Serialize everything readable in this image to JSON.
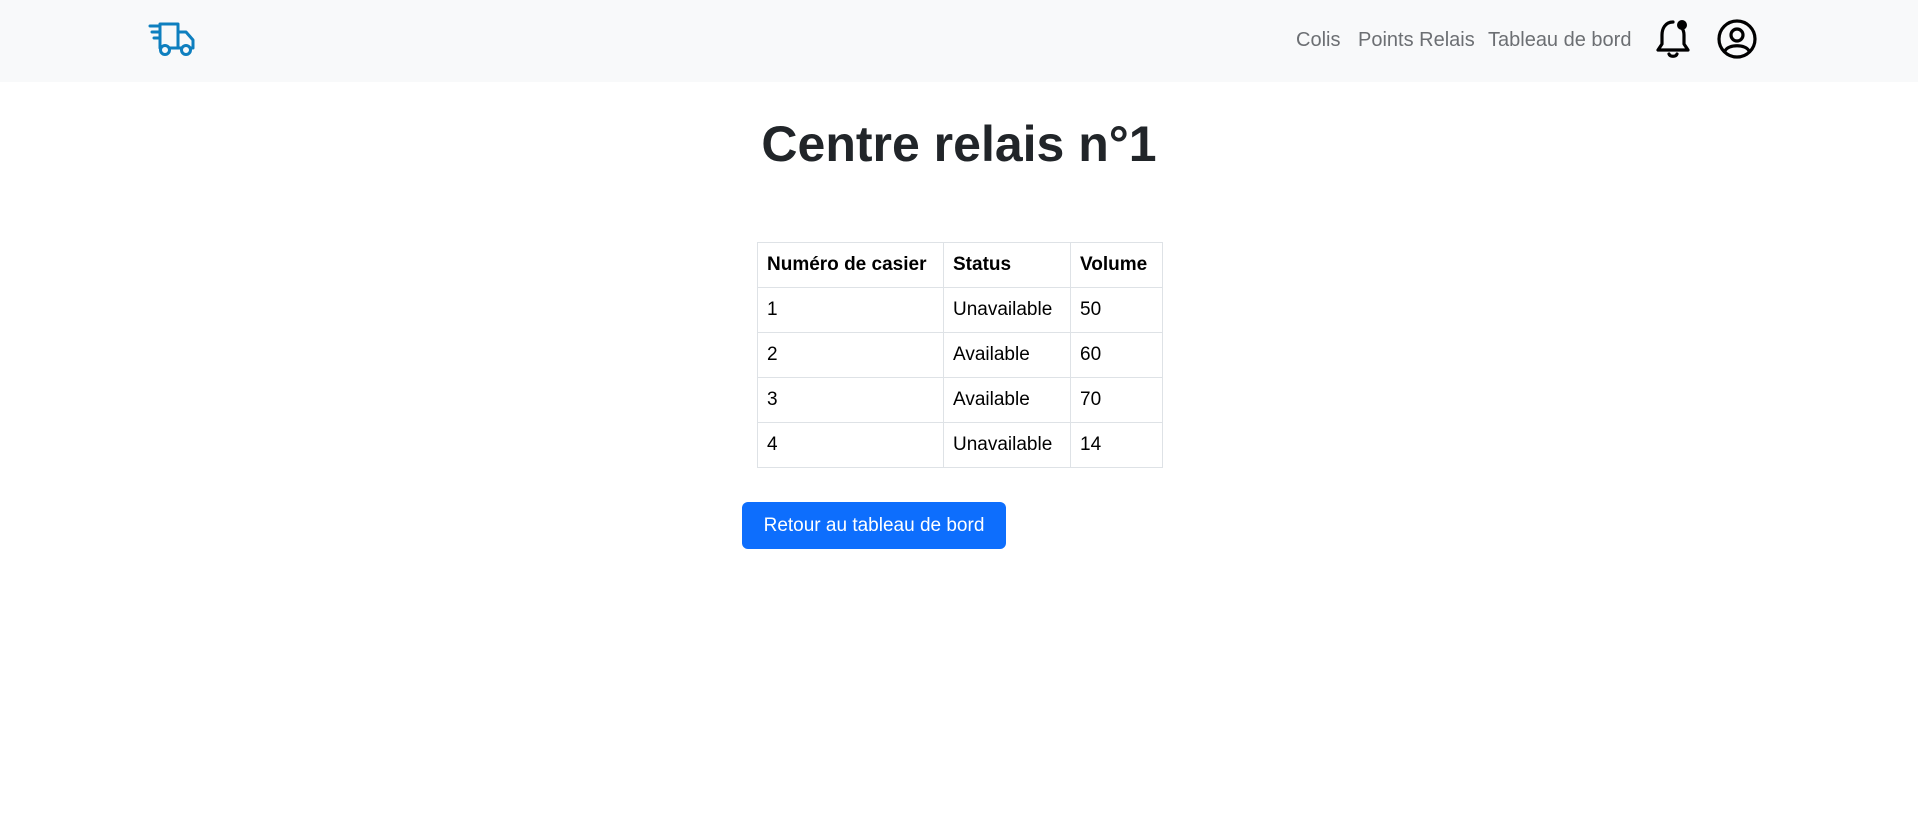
{
  "navbar": {
    "logo_icon": "delivery-truck-icon",
    "links": [
      {
        "label": "Colis"
      },
      {
        "label": "Points Relais"
      },
      {
        "label": "Tableau de bord"
      }
    ],
    "notification_icon": "bell-with-dot-icon",
    "account_icon": "user-circle-icon"
  },
  "page": {
    "title": "Centre relais n°1"
  },
  "table": {
    "headers": [
      "Numéro de casier",
      "Status",
      "Volume"
    ],
    "rows": [
      [
        "1",
        "Unavailable",
        "50"
      ],
      [
        "2",
        "Available",
        "60"
      ],
      [
        "3",
        "Available",
        "70"
      ],
      [
        "4",
        "Unavailable",
        "14"
      ]
    ]
  },
  "actions": {
    "back_label": "Retour au tableau de bord"
  },
  "colors": {
    "navbar_bg": "#f8f9fa",
    "primary": "#0d6efd",
    "logo": "#0e7fbf"
  }
}
